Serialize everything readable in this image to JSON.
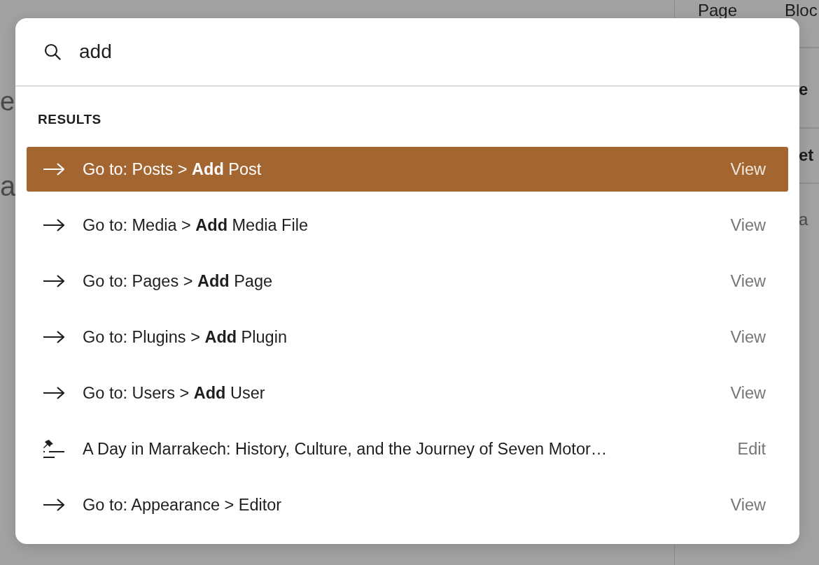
{
  "background_texts": [
    {
      "text": "e",
      "kind": "heading"
    },
    {
      "text": "a",
      "kind": "body"
    },
    {
      "text": "Page",
      "kind": "tab"
    },
    {
      "text": "Bloc",
      "kind": "tab"
    },
    {
      "text": "e",
      "kind": "panel-title"
    },
    {
      "text": "et",
      "kind": "panel-title"
    },
    {
      "text": "a",
      "kind": "panel-text"
    }
  ],
  "search": {
    "value": "add"
  },
  "results_heading": "RESULTS",
  "results": [
    {
      "kind": "navigate",
      "label": "Go to: Posts > **Add** Post",
      "action": "View",
      "selected": true
    },
    {
      "kind": "navigate",
      "label": "Go to: Media > **Add** Media File",
      "action": "View",
      "selected": false
    },
    {
      "kind": "navigate",
      "label": "Go to: Pages > **Add** Page",
      "action": "View",
      "selected": false
    },
    {
      "kind": "navigate",
      "label": "Go to: Plugins > **Add** Plugin",
      "action": "View",
      "selected": false
    },
    {
      "kind": "navigate",
      "label": "Go to: Users > **Add** User",
      "action": "View",
      "selected": false
    },
    {
      "kind": "post",
      "label": "A Day in Marrakech: History, Culture, and the Journey of Seven Motor…",
      "action": "Edit",
      "selected": false
    },
    {
      "kind": "navigate",
      "label": "Go to: Appearance > Editor",
      "action": "View",
      "selected": false
    }
  ]
}
